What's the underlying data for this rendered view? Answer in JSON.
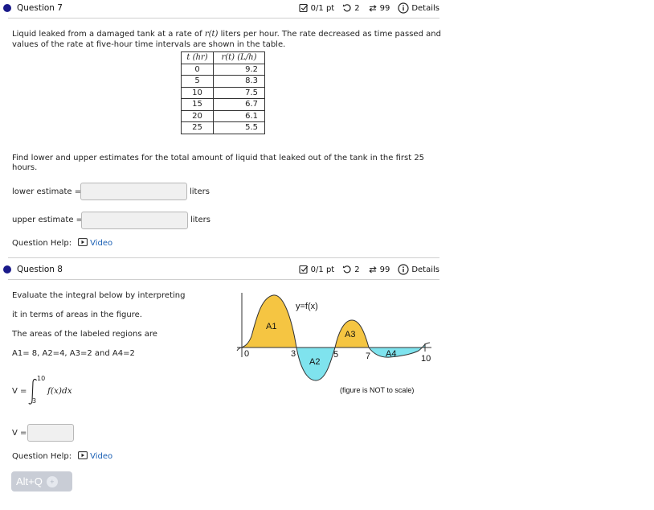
{
  "question7": {
    "title": "Question 7",
    "score": "0/1 pt",
    "attempts": "2",
    "submissions": "99",
    "details": "Details",
    "prompt_line1": "Liquid leaked from a damaged tank at a rate of",
    "prompt_rt": "r(t)",
    "prompt_line1_end": "liters per hour. The rate decreased as time passed and",
    "prompt_line2": "values of the rate at five-hour time intervals are shown in the table.",
    "table": {
      "headers": [
        "t (hr)",
        "r(t) (L/h)"
      ],
      "rows": [
        [
          "0",
          "9.2"
        ],
        [
          "5",
          "8.3"
        ],
        [
          "10",
          "7.5"
        ],
        [
          "15",
          "6.7"
        ],
        [
          "20",
          "6.1"
        ],
        [
          "25",
          "5.5"
        ]
      ]
    },
    "find_line1": "Find lower and upper estimates for the total amount of liquid that leaked out of the tank in the first 25",
    "find_line2": "hours.",
    "lower_label": "lower estimate =",
    "upper_label": "upper estimate =",
    "unit": "liters",
    "help_label": "Question Help:",
    "video_label": "Video"
  },
  "question8": {
    "title": "Question 8",
    "score": "0/1 pt",
    "attempts": "2",
    "submissions": "99",
    "details": "Details",
    "line1": "Evaluate the integral below by interpreting",
    "line2": "it in terms of areas in the figure.",
    "line3": "The areas of the labeled regions are",
    "line4": "A1= 8, A2=4, A3=2 and A4=2",
    "integral_prefix": "V =",
    "integral_upper": "10",
    "integral_lower": "3",
    "integrand": "f(x)dx",
    "v_label": "V =",
    "help_label": "Question Help:",
    "video_label": "Video",
    "figure": {
      "curve_label": "y=f(x)",
      "regions": [
        "A1",
        "A2",
        "A3",
        "A4"
      ],
      "ticks": [
        "0",
        "3",
        "5",
        "7",
        "10"
      ],
      "caption": "(figure is NOT to scale)",
      "fill_above": "#f5c542",
      "fill_below": "#7fe3ee"
    }
  },
  "alt_button": "Alt+Q"
}
